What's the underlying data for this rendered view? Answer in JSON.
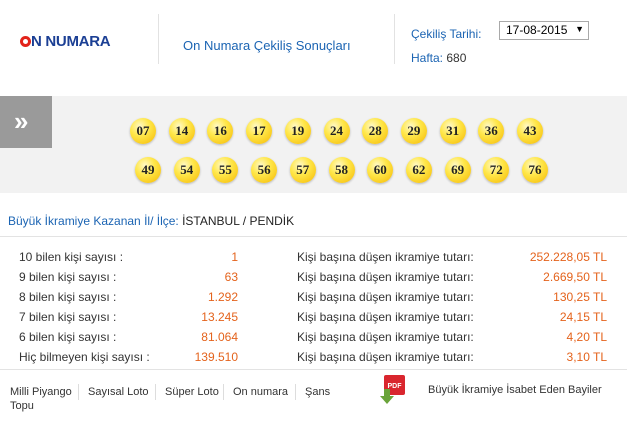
{
  "header": {
    "logo_text": "N NUMARA",
    "title": "On Numara Çekiliş Sonuçları",
    "date_label": "Çekiliş Tarihi:",
    "date_value": "17-08-2015",
    "week_label": "Hafta:",
    "week_value": "680"
  },
  "balls": {
    "row1": [
      "07",
      "14",
      "16",
      "17",
      "19",
      "24",
      "28",
      "29",
      "31",
      "36",
      "43"
    ],
    "row2": [
      "49",
      "54",
      "55",
      "56",
      "57",
      "58",
      "60",
      "62",
      "69",
      "72",
      "76"
    ]
  },
  "winner": {
    "label": "Büyük İkramiye Kazanan İl/ İlçe:",
    "value": "İSTANBUL / PENDİK"
  },
  "stats": [
    {
      "label": "10 bilen kişi sayısı :",
      "count": "1",
      "prize_label": "Kişi başına düşen ikramiye tutarı:",
      "prize": "252.228,05 TL"
    },
    {
      "label": "9 bilen kişi sayısı :",
      "count": "63",
      "prize_label": "Kişi başına düşen ikramiye tutarı:",
      "prize": "2.669,50 TL"
    },
    {
      "label": "8 bilen kişi sayısı :",
      "count": "1.292",
      "prize_label": "Kişi başına düşen ikramiye tutarı:",
      "prize": "130,25 TL"
    },
    {
      "label": "7 bilen kişi sayısı :",
      "count": "13.245",
      "prize_label": "Kişi başına düşen ikramiye tutarı:",
      "prize": "24,15 TL"
    },
    {
      "label": "6 bilen kişi sayısı :",
      "count": "81.064",
      "prize_label": "Kişi başına düşen ikramiye tutarı:",
      "prize": "4,20 TL"
    },
    {
      "label": "Hiç bilmeyen kişi sayısı :",
      "count": "139.510",
      "prize_label": "Kişi başına düşen ikramiye tutarı:",
      "prize": "3,10 TL"
    }
  ],
  "footer": {
    "links": [
      "Milli Piyango",
      "Sayısal Loto",
      "Süper Loto",
      "On numara",
      "Şans"
    ],
    "links_second_line": "Topu",
    "pdf_label": "PDF",
    "pdf_caption": "Büyük İkramiye İsabet Eden Bayiler"
  },
  "colors": {
    "brand_blue": "#1b3f94",
    "link_blue": "#1b64b3",
    "value_orange": "#e4631c",
    "ball_yellow": "#ffd21f",
    "pdf_red": "#d9262e"
  },
  "icons": {
    "nav": "double-chevron-right-icon",
    "pdf": "pdf-download-icon"
  }
}
